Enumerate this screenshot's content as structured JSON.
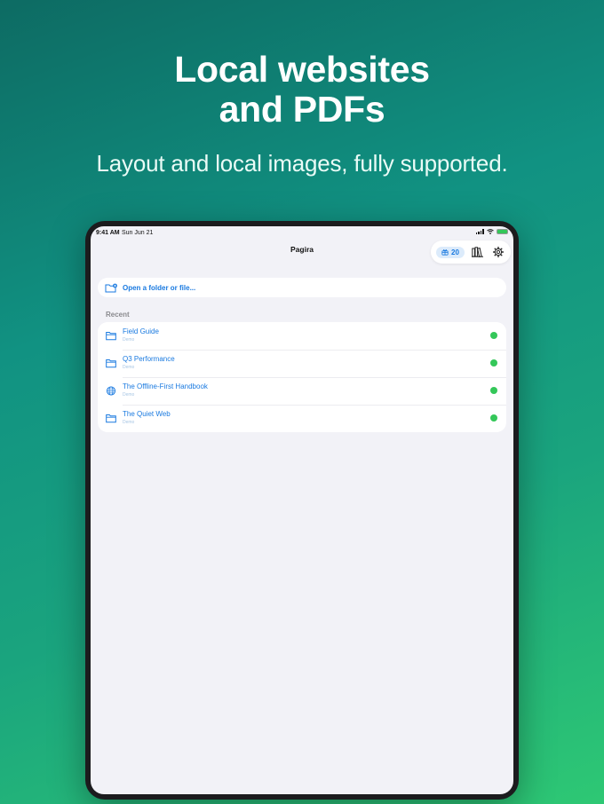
{
  "promo": {
    "headline_line1": "Local websites",
    "headline_line2": "and PDFs",
    "subheadline": "Layout and local images, fully supported."
  },
  "status_bar": {
    "time": "9:41 AM",
    "date": "Sun Jun 21",
    "battery_level": 1.0
  },
  "navbar": {
    "title": "Pagira",
    "gift_count": "20",
    "icons": [
      "gift-icon",
      "library-icon",
      "gear-icon"
    ]
  },
  "open_action": {
    "label": "Open a folder or file...",
    "icon": "folder-add-icon"
  },
  "recent": {
    "section_label": "Recent",
    "items": [
      {
        "title": "Field Guide",
        "subtitle": "Demo",
        "icon": "folder-icon"
      },
      {
        "title": "Q3 Performance",
        "subtitle": "Demo",
        "icon": "folder-icon"
      },
      {
        "title": "The Offline-First Handbook",
        "subtitle": "Demo",
        "icon": "globe-icon"
      },
      {
        "title": "The Quiet Web",
        "subtitle": "Demo",
        "icon": "folder-icon"
      }
    ]
  },
  "colors": {
    "accent": "#1a7ae0",
    "download_badge": "#34c759",
    "background_top": "#0d6b63",
    "background_bottom": "#2ec874"
  }
}
